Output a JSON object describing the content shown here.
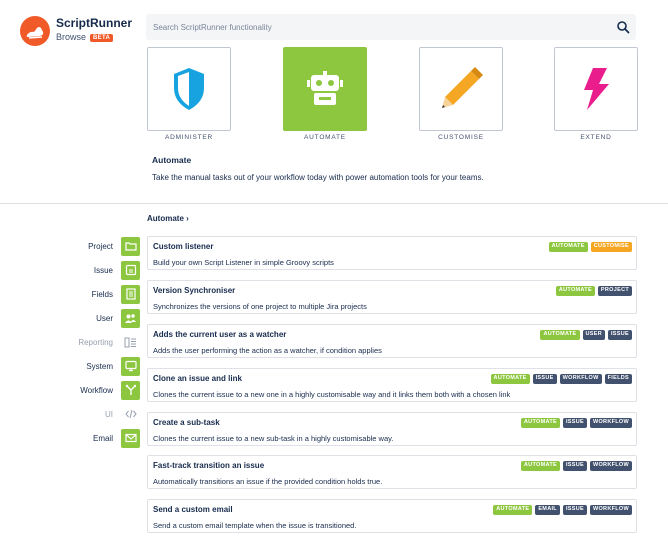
{
  "brand": {
    "title": "ScriptRunner",
    "subtitle": "Browse",
    "badge": "BETA"
  },
  "search": {
    "placeholder": "Search ScriptRunner functionality"
  },
  "categories": [
    {
      "label": "ADMINISTER",
      "icon": "shield-icon",
      "active": false
    },
    {
      "label": "AUTOMATE",
      "icon": "robot-icon",
      "active": true
    },
    {
      "label": "CUSTOMISE",
      "icon": "pencil-icon",
      "active": false
    },
    {
      "label": "EXTEND",
      "icon": "lightning-icon",
      "active": false
    }
  ],
  "section": {
    "title": "Automate",
    "description": "Take the manual tasks out of your workflow today with power automation tools for your teams."
  },
  "breadcrumb": "Automate ›",
  "sidebar": {
    "items": [
      {
        "label": "Project",
        "icon": "folder-icon"
      },
      {
        "label": "Issue",
        "icon": "issue-icon"
      },
      {
        "label": "Fields",
        "icon": "fields-icon"
      },
      {
        "label": "User",
        "icon": "users-icon"
      },
      {
        "label": "Reporting",
        "icon": "reporting-icon"
      },
      {
        "label": "System",
        "icon": "monitor-icon"
      },
      {
        "label": "Workflow",
        "icon": "workflow-icon"
      },
      {
        "label": "UI",
        "icon": "code-icon"
      },
      {
        "label": "Email",
        "icon": "email-icon"
      }
    ]
  },
  "cards": [
    {
      "title": "Custom listener",
      "desc": "Build your own Script Listener in simple Groovy scripts",
      "tags": [
        "AUTOMATE",
        "CUSTOMISE"
      ]
    },
    {
      "title": "Version Synchroniser",
      "desc": "Synchronizes the versions of one project to multiple Jira projects",
      "tags": [
        "AUTOMATE",
        "PROJECT"
      ]
    },
    {
      "title": "Adds the current user as a watcher",
      "desc": "Adds the user performing the action as a watcher, if condition applies",
      "tags": [
        "AUTOMATE",
        "USER",
        "ISSUE"
      ]
    },
    {
      "title": "Clone an issue and link",
      "desc": "Clones the current issue to a new one in a highly customisable way and it links them both with a chosen link",
      "tags": [
        "AUTOMATE",
        "ISSUE",
        "WORKFLOW",
        "FIELDS"
      ]
    },
    {
      "title": "Create a sub-task",
      "desc": "Clones the current issue to a new sub-task in a highly customisable way.",
      "tags": [
        "AUTOMATE",
        "ISSUE",
        "WORKFLOW"
      ]
    },
    {
      "title": "Fast-track transition an issue",
      "desc": "Automatically transitions an issue if the provided condition holds true.",
      "tags": [
        "AUTOMATE",
        "ISSUE",
        "WORKFLOW"
      ]
    },
    {
      "title": "Send a custom email",
      "desc": "Send a custom email template when the issue is transitioned.",
      "tags": [
        "AUTOMATE",
        "EMAIL",
        "ISSUE",
        "WORKFLOW"
      ]
    }
  ],
  "colors": {
    "accent": "#8dc63f",
    "brand": "#f05a28",
    "customise": "#f5a623",
    "tag_dark": "#42526e"
  }
}
